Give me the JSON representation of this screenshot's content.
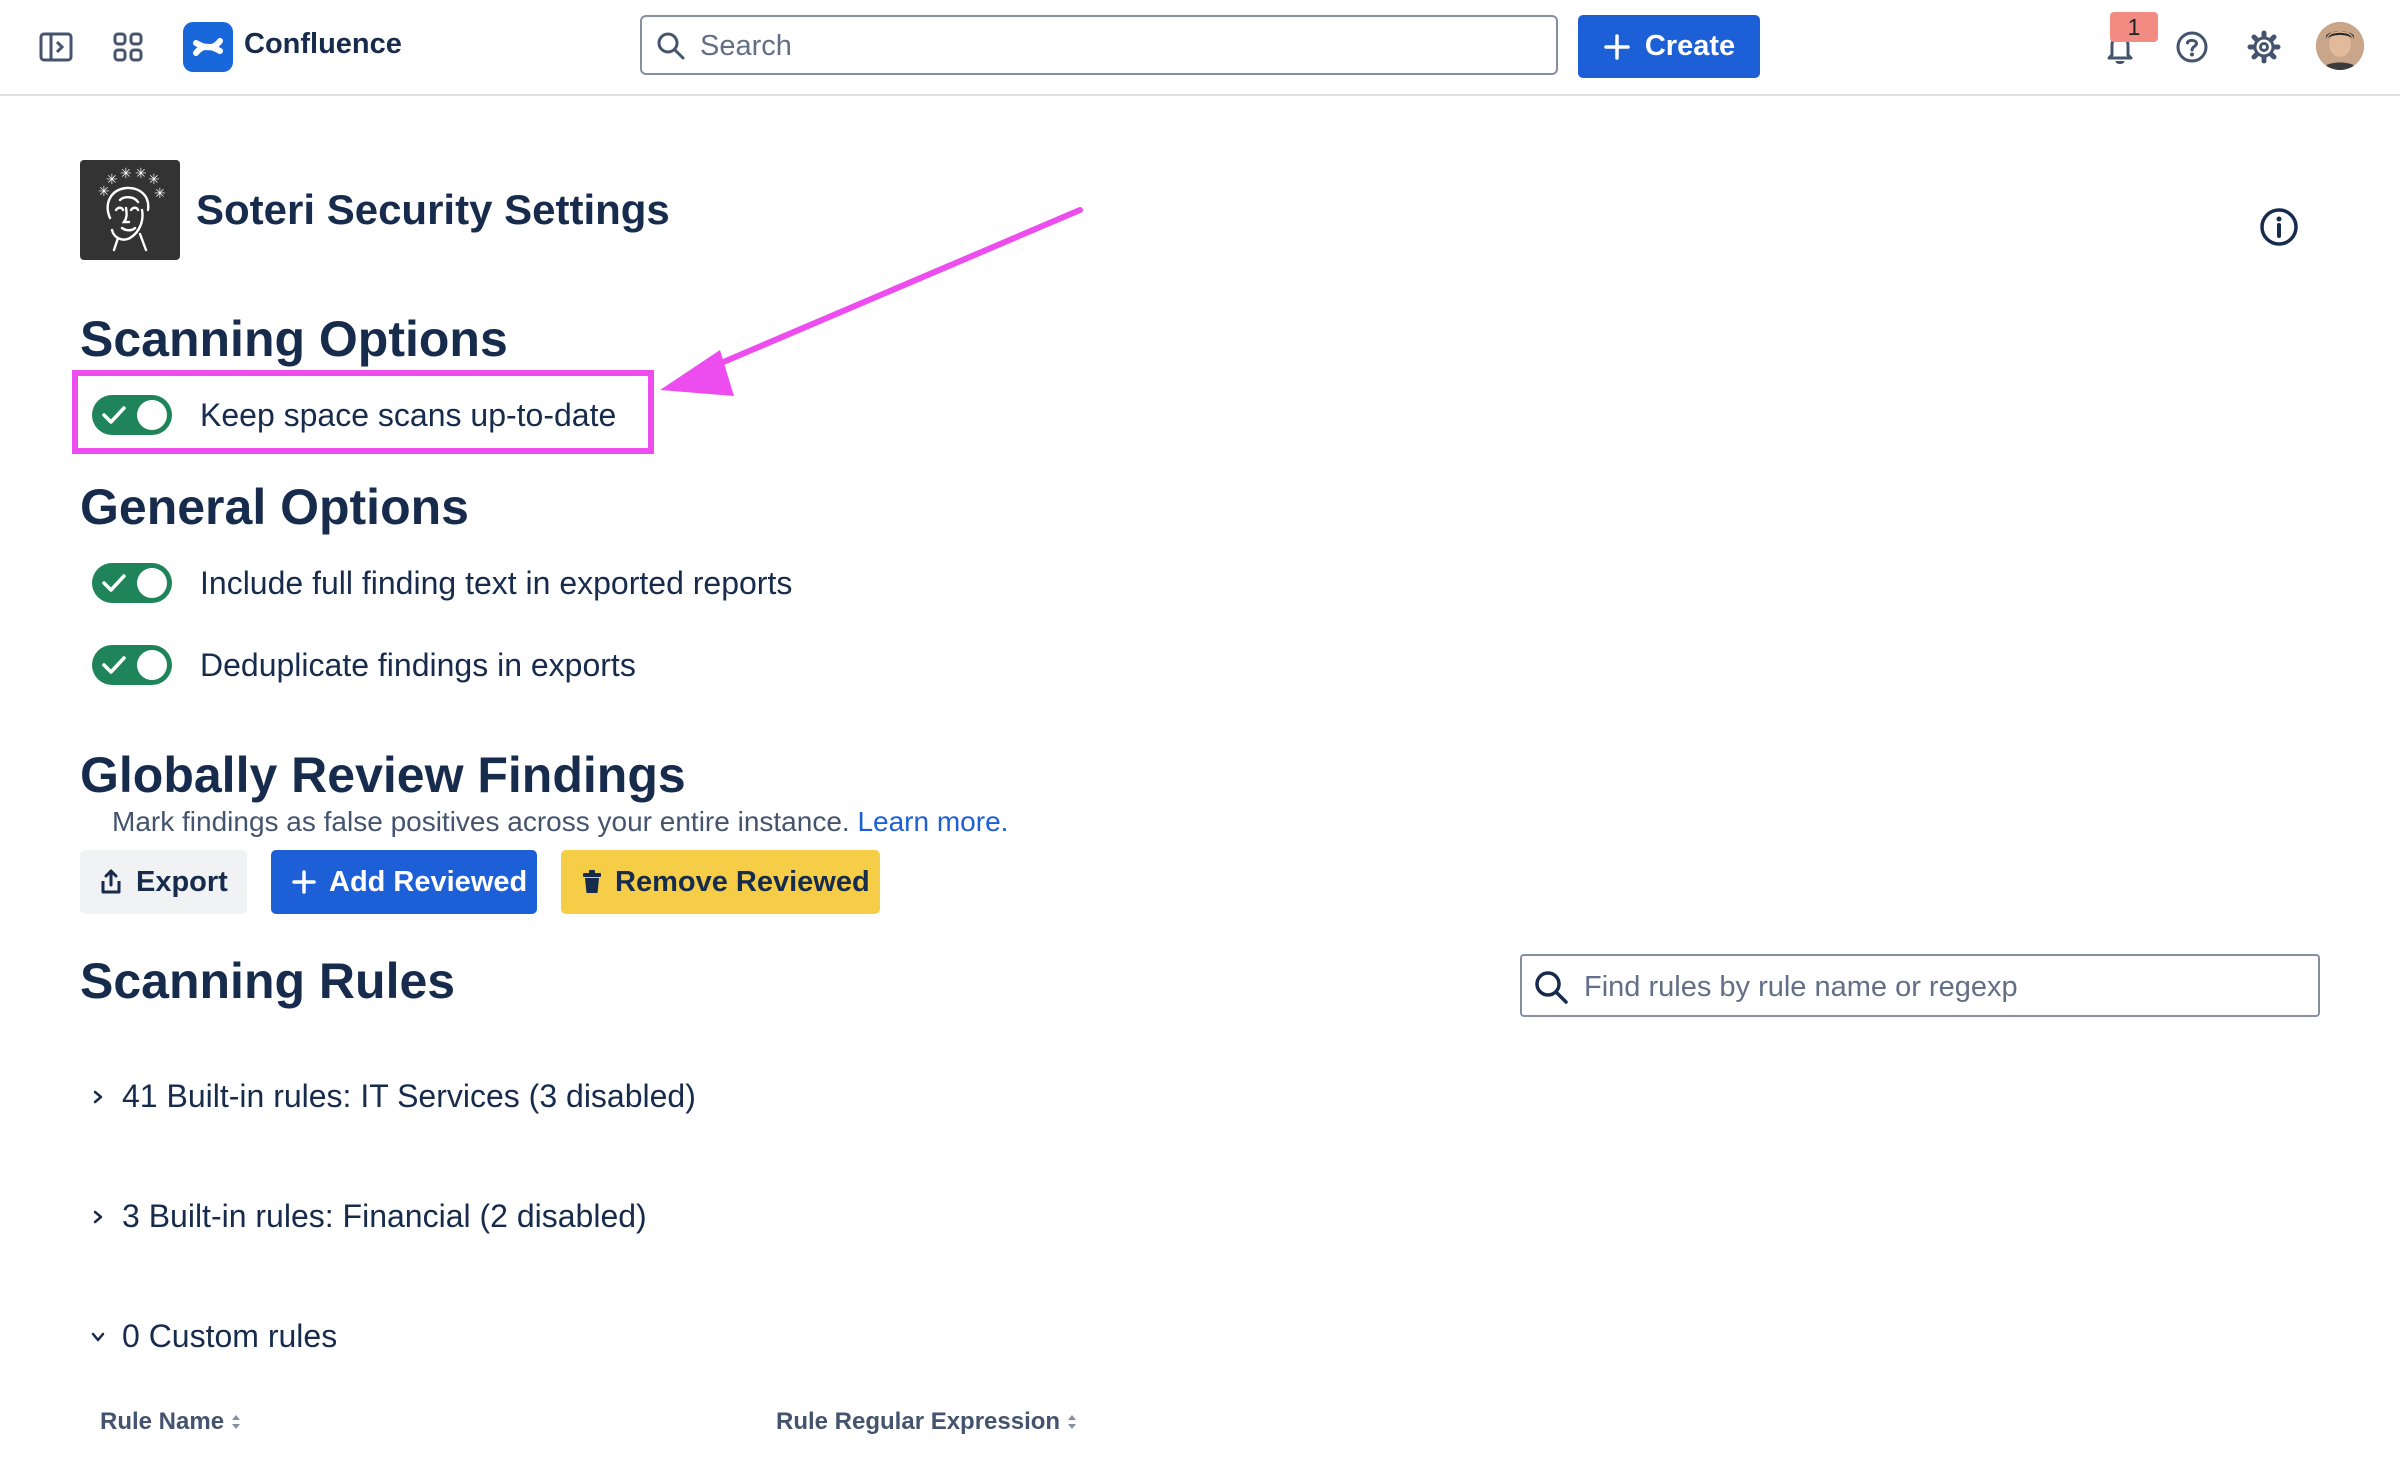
{
  "app": {
    "product_name": "Confluence",
    "search_placeholder": "Search",
    "create_label": "Create",
    "notification_count": "1",
    "accent_color": "#1d5fd6"
  },
  "page": {
    "title": "Soteri Security Settings"
  },
  "scanning_options": {
    "heading": "Scanning Options",
    "toggles": [
      {
        "label": "Keep space scans up-to-date",
        "enabled": true
      }
    ]
  },
  "general_options": {
    "heading": "General Options",
    "toggles": [
      {
        "label": "Include full finding text in exported reports",
        "enabled": true
      },
      {
        "label": "Deduplicate findings in exports",
        "enabled": true
      }
    ]
  },
  "review_findings": {
    "heading": "Globally Review Findings",
    "description": "Mark findings as false positives across your entire instance.",
    "learn_more": "Learn more.",
    "buttons": {
      "export": "Export",
      "add_reviewed": "Add Reviewed",
      "remove_reviewed": "Remove Reviewed"
    }
  },
  "scanning_rules": {
    "heading": "Scanning Rules",
    "search_placeholder": "Find rules by rule name or regexp",
    "groups": [
      {
        "label": "41 Built-in rules: IT Services (3 disabled)",
        "expanded": false
      },
      {
        "label": "3 Built-in rules: Financial (2 disabled)",
        "expanded": false
      },
      {
        "label": "0 Custom rules",
        "expanded": true
      }
    ],
    "table_columns": [
      "Rule Name",
      "Rule Regular Expression"
    ]
  },
  "icons": {
    "sidebar_toggle": "sidebar-toggle-icon",
    "app_switcher": "app-switcher-icon",
    "notifications": "bell-icon",
    "help": "help-icon",
    "settings": "gear-icon",
    "info": "info-icon"
  },
  "annotation": {
    "highlight_color": "#ed4dee"
  }
}
